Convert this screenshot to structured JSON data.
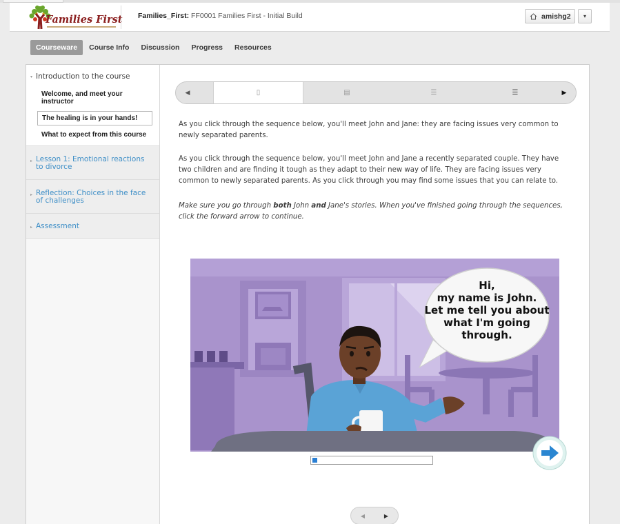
{
  "header": {
    "logo_text": "Families First",
    "course_org": "Families_First:",
    "course_name": "FF0001 Families First - Initial Build",
    "username": "amishg2"
  },
  "course_tabs": [
    "Courseware",
    "Course Info",
    "Discussion",
    "Progress",
    "Resources"
  ],
  "sidebar": {
    "chapters": [
      {
        "title": "Introduction to the course",
        "sections": [
          "Welcome, and meet your instructor",
          "The healing is in your hands!",
          "What to expect from this course"
        ]
      },
      {
        "title": "Lesson 1: Emotional reactions to divorce"
      },
      {
        "title": "Reflection: Choices in the face of challenges"
      },
      {
        "title": "Assessment"
      }
    ]
  },
  "content": {
    "para1": "As you click through the sequence below, you'll meet John and Jane: they are facing issues very common to newly separated parents.",
    "para2": "As you click through the sequence below, you'll meet John and Jane a recently separated couple. They have two children and are finding it tough as they adapt to their new way of life. They are facing issues very common to newly separated parents. As you click through you may find some issues that you can relate to.",
    "para3_a": "Make sure you go through ",
    "para3_b": "both",
    "para3_c": " John ",
    "para3_d": "and",
    "para3_e": " Jane's stories. When you've finished going through the sequences, click the forward arrow to continue.",
    "speech_line1": "Hi,",
    "speech_line2": "my name is John.",
    "speech_line3": "Let me tell you about",
    "speech_line4": "what I'm going",
    "speech_line5": "through.",
    "slide_progress": 0.04
  },
  "colors": {
    "accent_link": "#3f8fc7",
    "scene_bg": "#a993cc",
    "next_button": "#2a86d1",
    "progress_fill": "#2a7fd4"
  }
}
